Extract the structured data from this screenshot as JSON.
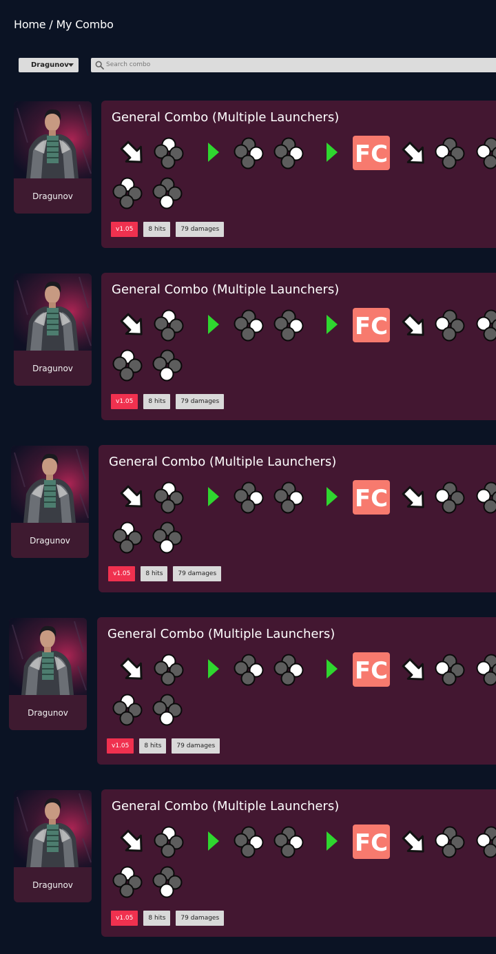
{
  "breadcrumb": {
    "home": "Home",
    "separator": "/",
    "current": "My Combo"
  },
  "filter": {
    "character_selected": "Dragunov",
    "search_placeholder": "Search combo"
  },
  "colors": {
    "background": "#0b1324",
    "card": "#431731",
    "version_tag": "#f0314f",
    "fc_badge": "#f77a6e",
    "arrow_green": "#2fd62f"
  },
  "combo_sequence": [
    "df-arrow-icon",
    "button-lp-icon",
    "green-arrow-icon",
    "button-rk-icon",
    "button-rk-icon",
    "green-arrow-icon",
    "fc-badge",
    "df-arrow-icon",
    "button-lk-icon",
    "button-lp-icon",
    "button-lp-icon",
    "button-lk-icon"
  ],
  "fc_label": "FC",
  "combos": [
    {
      "character": "Dragunov",
      "title": "General Combo (Multiple Launchers)",
      "version": "v1.05",
      "hits": "8 hits",
      "damage": "79 damages"
    },
    {
      "character": "Dragunov",
      "title": "General Combo (Multiple Launchers)",
      "version": "v1.05",
      "hits": "8 hits",
      "damage": "79 damages"
    },
    {
      "character": "Dragunov",
      "title": "General Combo (Multiple Launchers)",
      "version": "v1.05",
      "hits": "8 hits",
      "damage": "79 damages"
    },
    {
      "character": "Dragunov",
      "title": "General Combo (Multiple Launchers)",
      "version": "v1.05",
      "hits": "8 hits",
      "damage": "79 damages"
    },
    {
      "character": "Dragunov",
      "title": "General Combo (Multiple Launchers)",
      "version": "v1.05",
      "hits": "8 hits",
      "damage": "79 damages"
    }
  ]
}
